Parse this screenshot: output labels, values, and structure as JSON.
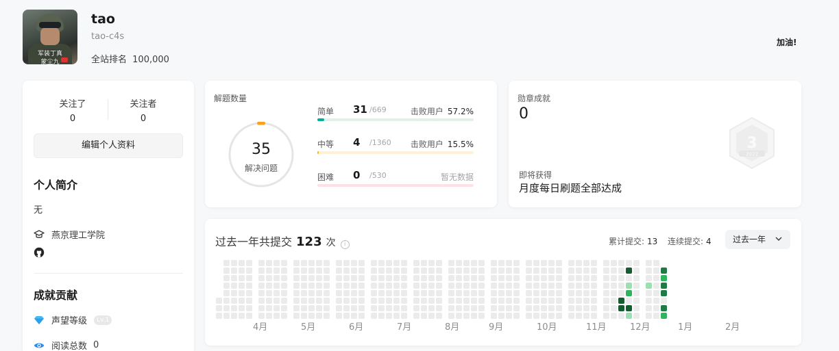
{
  "profile": {
    "name": "tao",
    "handle": "tao-c4s",
    "rank_label": "全站排名",
    "rank_value": "100,000",
    "avatar_caption_line1": "军装丁真",
    "avatar_caption_line2": "蒙尘九",
    "cheer": "加油!"
  },
  "sidebar": {
    "following_label": "关注了",
    "following_count": "0",
    "followers_label": "关注者",
    "followers_count": "0",
    "edit_button": "编辑个人资料",
    "intro_title": "个人简介",
    "bio": "无",
    "school_icon": "graduation-cap-icon",
    "school": "燕京理工学院",
    "github_icon": "github-icon",
    "contrib_title": "成就贡献",
    "reputation_icon": "diamond-icon",
    "reputation_label": "声望等级",
    "reputation_badge": "Lv.1",
    "reads_icon": "eye-icon",
    "reads_label": "阅读总数",
    "reads_value": "0"
  },
  "solved": {
    "label": "解题数量",
    "total": "35",
    "total_label": "解决问题",
    "difficulties": [
      {
        "label": "简单",
        "solved": "31",
        "total": "/669",
        "beat_label": "击败用户",
        "beat": "57.2%",
        "fill": 0.046,
        "color": "#00af9b",
        "track": "#e0f2e5"
      },
      {
        "label": "中等",
        "solved": "4",
        "total": "/1360",
        "beat_label": "击败用户",
        "beat": "15.5%",
        "fill": 0.003,
        "color": "#ffb800",
        "track": "#fff1d6"
      },
      {
        "label": "困难",
        "solved": "0",
        "total": "/530",
        "beat_label": "",
        "beat": "暂无数据",
        "fill": 0,
        "color": "#ff2d55",
        "track": "#ffe1e5"
      }
    ],
    "ring_track_color": "#e5e5e5",
    "ring_accent_color": "#ffa116"
  },
  "badges": {
    "label": "勋章成就",
    "count": "0",
    "upcoming_label": "即将获得",
    "upcoming_name": "月度每日刷题全部达成",
    "badge_icon": "monthly-badge-icon",
    "badge_year": "2022"
  },
  "calendar": {
    "title_prefix": "过去一年共提交",
    "total": "123",
    "unit": "次",
    "info_icon": "info-icon",
    "cumulative_label": "累计提交:",
    "cumulative_value": "13",
    "streak_label": "连续提交:",
    "streak_value": "4",
    "range_select": "过去一年",
    "months": [
      "4月",
      "5月",
      "6月",
      "7月",
      "8月",
      "9月",
      "10月",
      "11月",
      "12月",
      "1月",
      "2月"
    ],
    "empty_color": "#ebebeb",
    "level_colors": [
      "#ebebeb",
      "#9be0b1",
      "#2cb55d",
      "#1f7a43",
      "#155c30"
    ],
    "active_days": [
      {
        "week": 48,
        "day": 1,
        "level": 4
      },
      {
        "week": 48,
        "day": 3,
        "level": 1
      },
      {
        "week": 48,
        "day": 4,
        "level": 2
      },
      {
        "week": 48,
        "day": 6,
        "level": 4
      },
      {
        "week": 48,
        "day": 7,
        "level": 1
      },
      {
        "week": 47,
        "day": 5,
        "level": 4
      },
      {
        "week": 47,
        "day": 6,
        "level": 4
      },
      {
        "week": 50,
        "day": 3,
        "level": 1
      },
      {
        "week": 52,
        "day": 1,
        "level": 3
      },
      {
        "week": 52,
        "day": 2,
        "level": 2
      },
      {
        "week": 52,
        "day": 3,
        "level": 3
      },
      {
        "week": 52,
        "day": 4,
        "level": 3
      },
      {
        "week": 52,
        "day": 6,
        "level": 3
      },
      {
        "week": 52,
        "day": 7,
        "level": 2
      }
    ]
  }
}
